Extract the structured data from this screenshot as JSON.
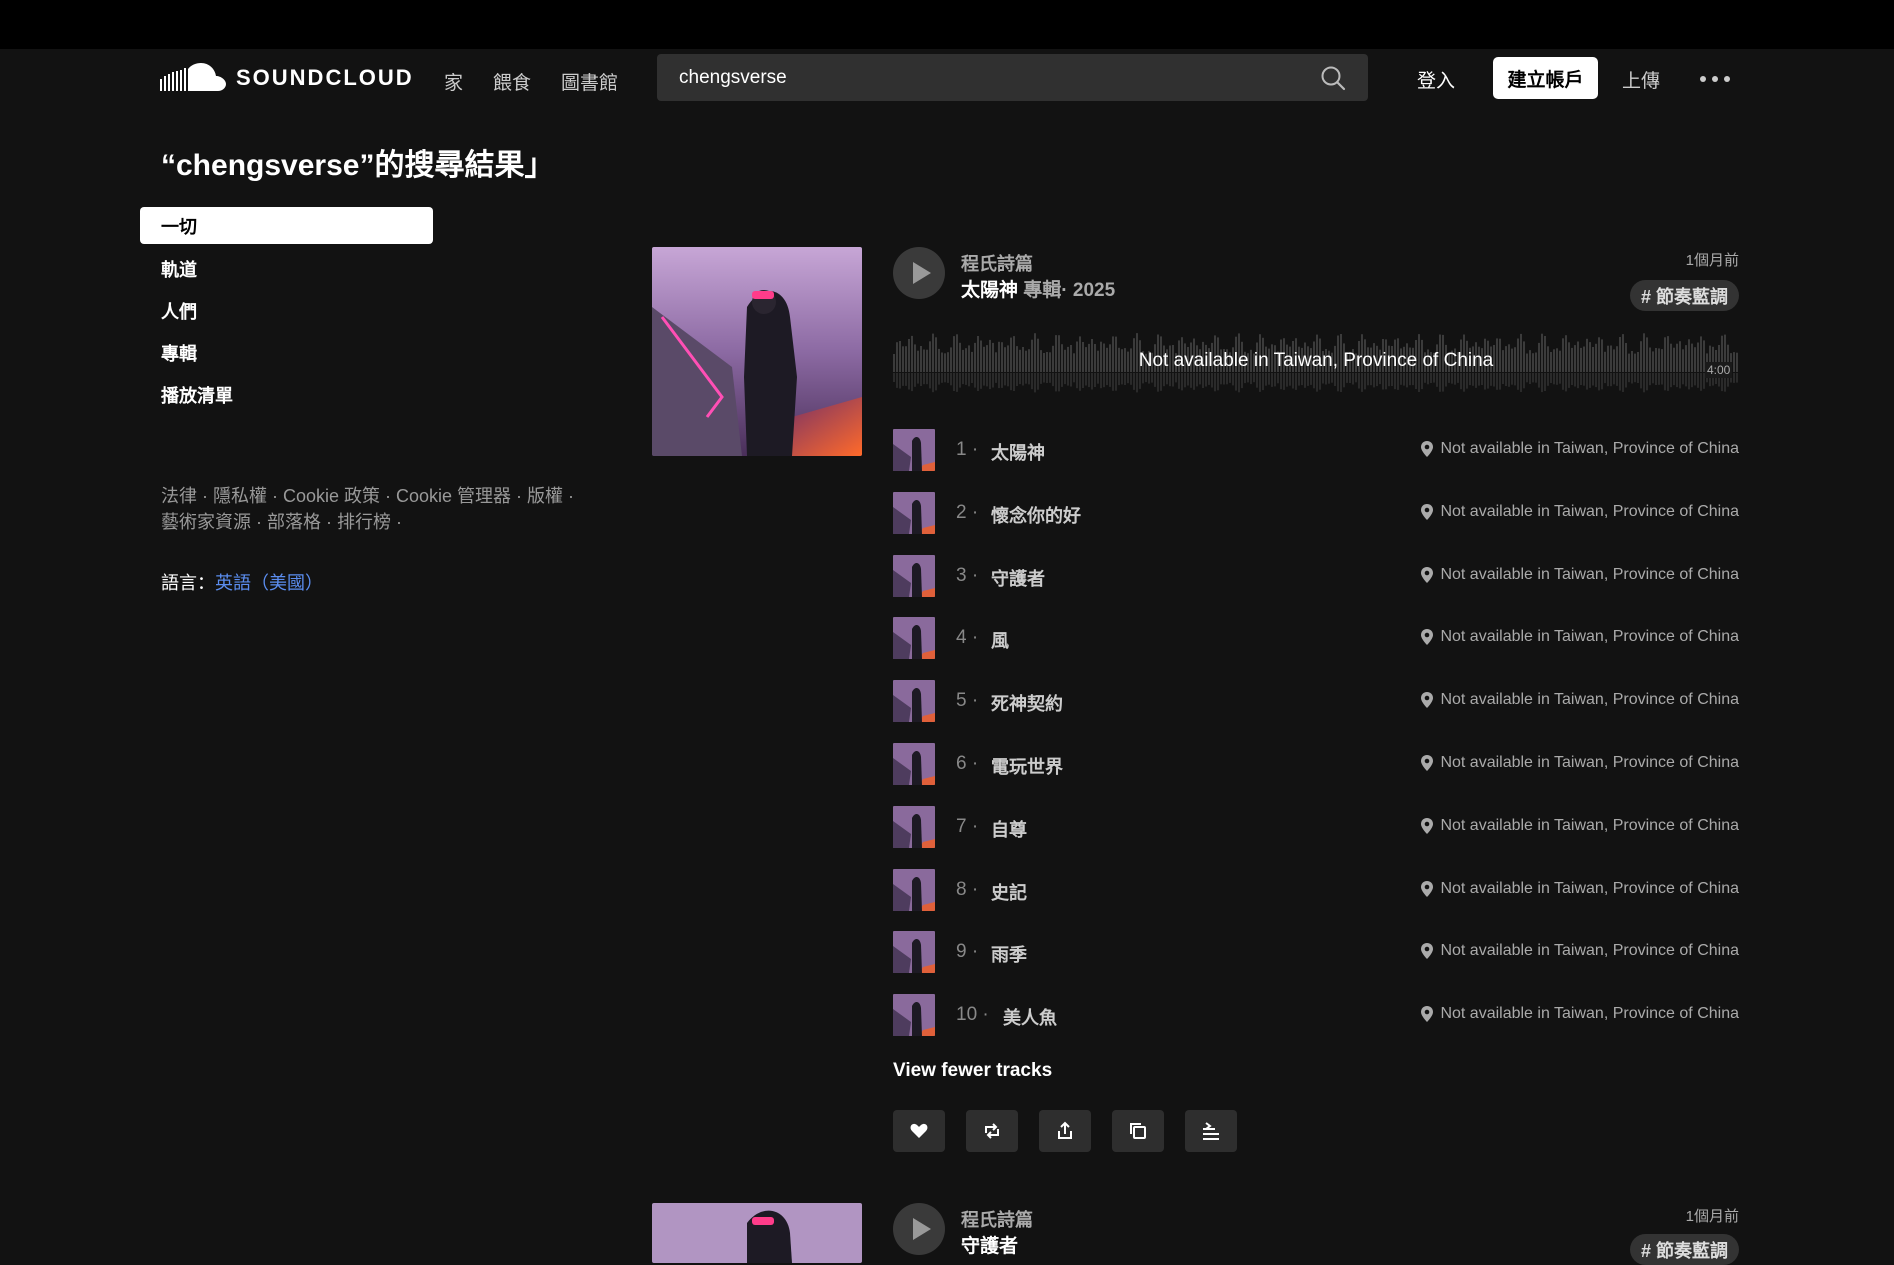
{
  "header": {
    "logo_text": "SOUNDCLOUD",
    "nav": [
      "家",
      "餵食",
      "圖書館"
    ],
    "search_value": "chengsverse",
    "login": "登入",
    "signup": "建立帳戶",
    "upload": "上傳"
  },
  "page_title": "“chengsverse”的搜尋結果」",
  "filters": [
    "一切",
    "軌道",
    "人們",
    "專輯",
    "播放清單"
  ],
  "footer": {
    "line1": "法律 · 隱私權 · Cookie 政策 · Cookie 管理器 · 版權 ·",
    "line2": "藝術家資源 · 部落格 · 排行榜 ·",
    "lang_label": "語言：",
    "lang_value": "英語（美國）"
  },
  "result1": {
    "artist": "程氏詩篇",
    "title": "太陽神",
    "meta": " 專輯· 2025",
    "time_ago": "1個月前",
    "tag": "# 節奏藍調",
    "wave_message": "Not available in Taiwan, Province of China",
    "duration": "4:00",
    "tracks": [
      {
        "num": "1 ·",
        "title": "太陽神",
        "status": "Not available in Taiwan, Province of China"
      },
      {
        "num": "2 ·",
        "title": "懷念你的好",
        "status": "Not available in Taiwan, Province of China"
      },
      {
        "num": "3 ·",
        "title": "守護者",
        "status": "Not available in Taiwan, Province of China"
      },
      {
        "num": "4 ·",
        "title": "風",
        "status": "Not available in Taiwan, Province of China"
      },
      {
        "num": "5 ·",
        "title": "死神契約",
        "status": "Not available in Taiwan, Province of China"
      },
      {
        "num": "6 ·",
        "title": "電玩世界",
        "status": "Not available in Taiwan, Province of China"
      },
      {
        "num": "7 ·",
        "title": "自尊",
        "status": "Not available in Taiwan, Province of China"
      },
      {
        "num": "8 ·",
        "title": "史記",
        "status": "Not available in Taiwan, Province of China"
      },
      {
        "num": "9 ·",
        "title": "雨季",
        "status": "Not available in Taiwan, Province of China"
      },
      {
        "num": "10 ·",
        "title": "美人魚",
        "status": "Not available in Taiwan, Province of China"
      }
    ],
    "view_fewer": "View fewer tracks",
    "actions": [
      "heart-icon",
      "repost-icon",
      "share-icon",
      "copy-link-icon",
      "add-to-playlist-icon"
    ]
  },
  "result2": {
    "artist": "程氏詩篇",
    "title": "守護者",
    "time_ago": "1個月前"
  },
  "colors": {
    "background": "#121212",
    "accent_link": "#5b8def"
  }
}
